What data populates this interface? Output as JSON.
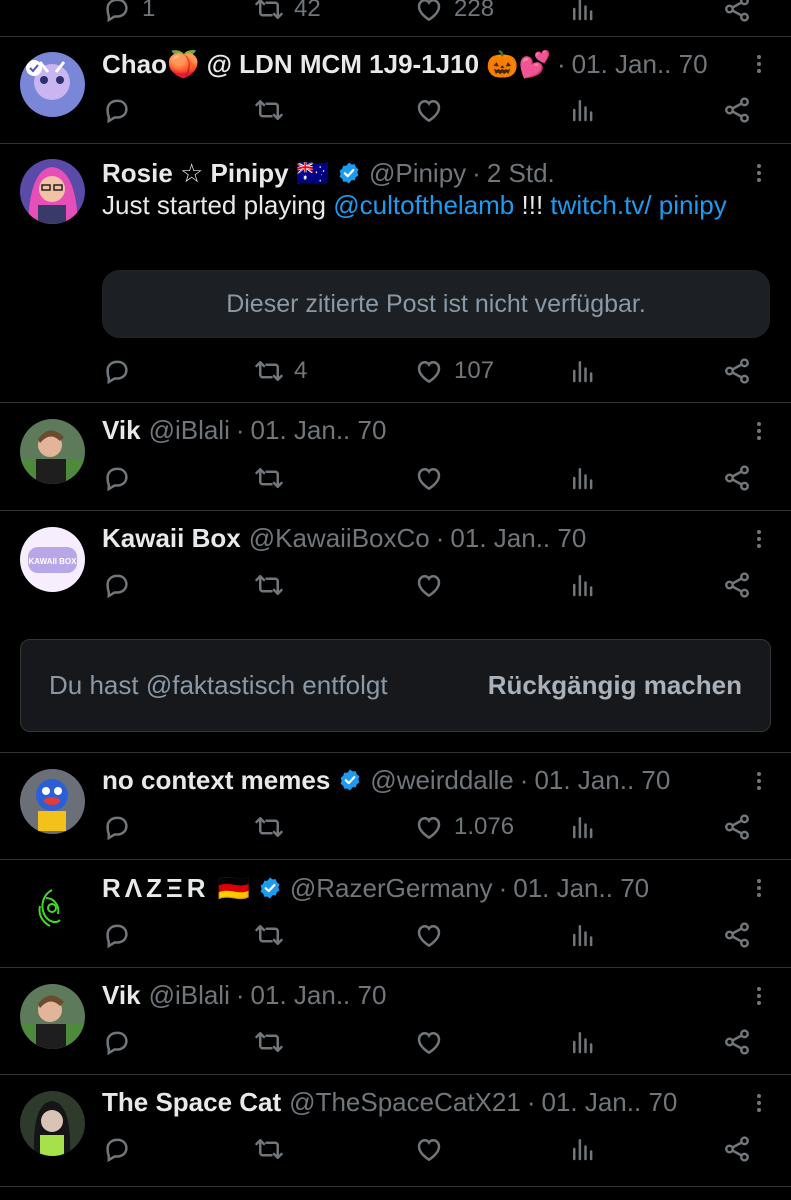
{
  "top_partial": {
    "reply_count": "1",
    "retweet_count": "42",
    "like_count": "228"
  },
  "posts": [
    {
      "name": "Chao🍑 @ LDN MCM 1J9-1J10 🎃💕",
      "handle": "",
      "time": "01. Jan.. 70",
      "verified": false,
      "flag": "",
      "counts": {
        "reply": "",
        "retweet": "",
        "like": "",
        "views": ""
      }
    },
    {
      "name": "Rosie ☆ Pinipy",
      "handle": "@Pinipy",
      "time": "2 Std.",
      "verified": true,
      "flag": "🇦🇺",
      "text_before": "Just started playing ",
      "text_link1": "@cultofthelamb",
      "text_mid": " !!! ",
      "text_link2": "twitch.tv/ pinipy",
      "quote_text": "Dieser zitierte Post ist nicht verfügbar.",
      "counts": {
        "reply": "",
        "retweet": "4",
        "like": "107",
        "views": ""
      }
    },
    {
      "name": "Vik",
      "handle": "@iBlali",
      "time": "01. Jan.. 70",
      "verified": false,
      "flag": "",
      "counts": {
        "reply": "",
        "retweet": "",
        "like": "",
        "views": ""
      }
    },
    {
      "name": "Kawaii Box",
      "handle": "@KawaiiBoxCo",
      "time": "01. Jan.. 70",
      "verified": false,
      "flag": "",
      "avatar_text": "KAWAII BOX",
      "counts": {
        "reply": "",
        "retweet": "",
        "like": "",
        "views": ""
      }
    },
    {
      "name": "no context memes",
      "handle": "@weirddalle",
      "time": "01. Jan.. 70",
      "verified": true,
      "flag": "",
      "counts": {
        "reply": "",
        "retweet": "",
        "like": "1.076",
        "views": ""
      }
    },
    {
      "name": "RΛZΞR",
      "handle": "@RazerGermany",
      "time": "01. Jan.. 70",
      "verified": true,
      "flag": "🇩🇪",
      "counts": {
        "reply": "",
        "retweet": "",
        "like": "",
        "views": ""
      }
    },
    {
      "name": "Vik",
      "handle": "@iBlali",
      "time": "01. Jan.. 70",
      "verified": false,
      "flag": "",
      "counts": {
        "reply": "",
        "retweet": "",
        "like": "",
        "views": ""
      }
    },
    {
      "name": "The Space Cat",
      "handle": "@TheSpaceCatX21",
      "time": "01. Jan.. 70",
      "verified": false,
      "flag": "",
      "counts": {
        "reply": "",
        "retweet": "",
        "like": "",
        "views": ""
      }
    }
  ],
  "unfollow_banner": {
    "message": "Du hast @faktastisch entfolgt",
    "undo_label": "Rückgängig machen"
  },
  "icons": {
    "reply": "reply-icon",
    "retweet": "retweet-icon",
    "like": "heart-icon",
    "views": "views-icon",
    "share": "share-icon",
    "more": "more-icon",
    "verified": "verified-badge-icon"
  },
  "colors": {
    "background": "#000000",
    "text": "#e7e9ea",
    "muted": "#71767b",
    "link": "#1d9bf0",
    "verified": "#1d9bf0",
    "divider": "#2f3336"
  }
}
